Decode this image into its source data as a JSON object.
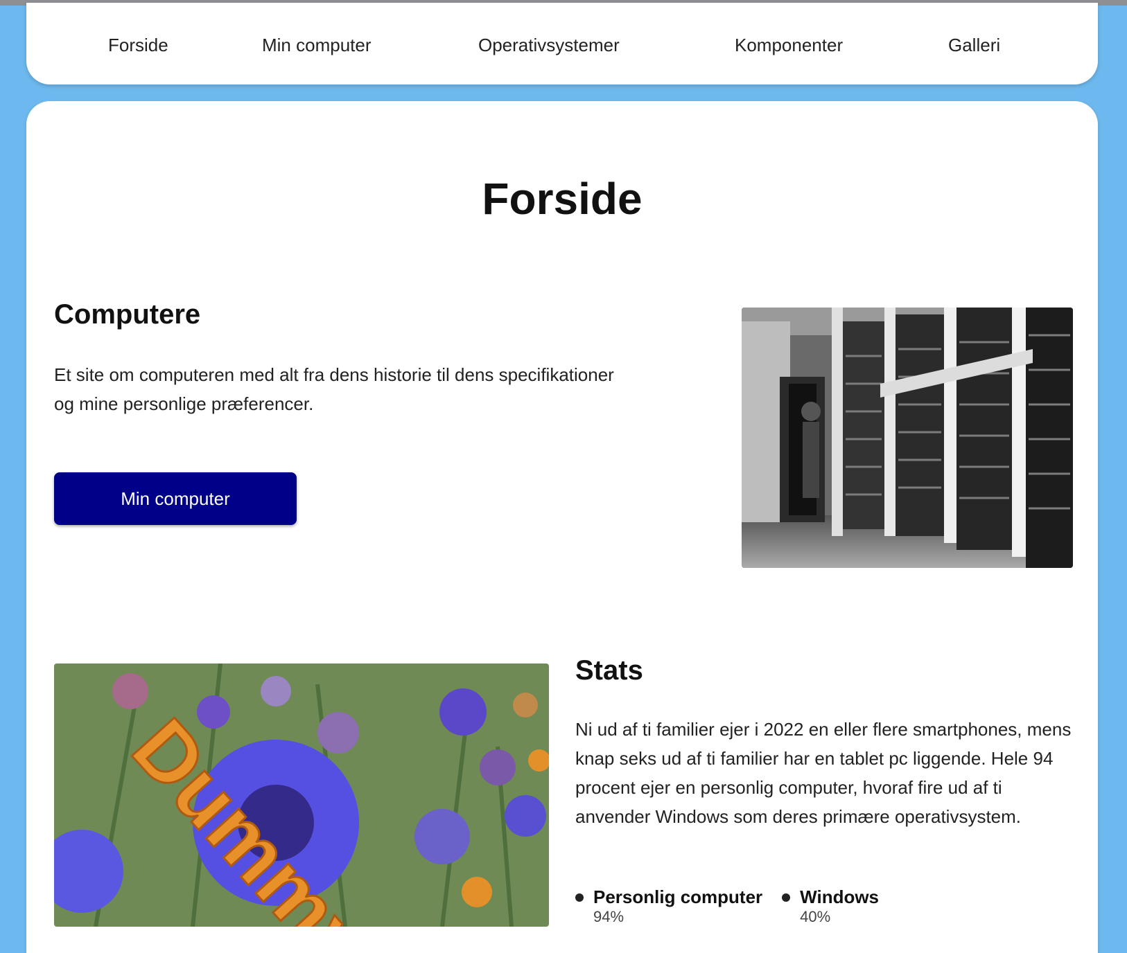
{
  "nav": {
    "items": [
      {
        "label": "Forside"
      },
      {
        "label": "Min computer"
      },
      {
        "label": "Operativsystemer"
      },
      {
        "label": "Komponenter"
      },
      {
        "label": "Galleri"
      }
    ]
  },
  "page": {
    "title": "Forside"
  },
  "computers": {
    "heading": "Computere",
    "text": "Et site om computeren med alt fra dens historie til dens specifikationer og mine personlige præferencer.",
    "button_label": "Min computer"
  },
  "stats": {
    "heading": "Stats",
    "text": "Ni ud af ti familier ejer i 2022 en eller flere smartphones, mens knap seks ud af ti familier har en tablet pc liggende. Hele 94 procent ejer en personlig computer, hvoraf fire ud af ti anvender Windows som deres primære operativsystem.",
    "items": [
      {
        "label": "Personlig computer",
        "value": "94%"
      },
      {
        "label": "Windows",
        "value": "40%"
      }
    ]
  },
  "flower_image": {
    "overlay_text": "Dummy"
  }
}
